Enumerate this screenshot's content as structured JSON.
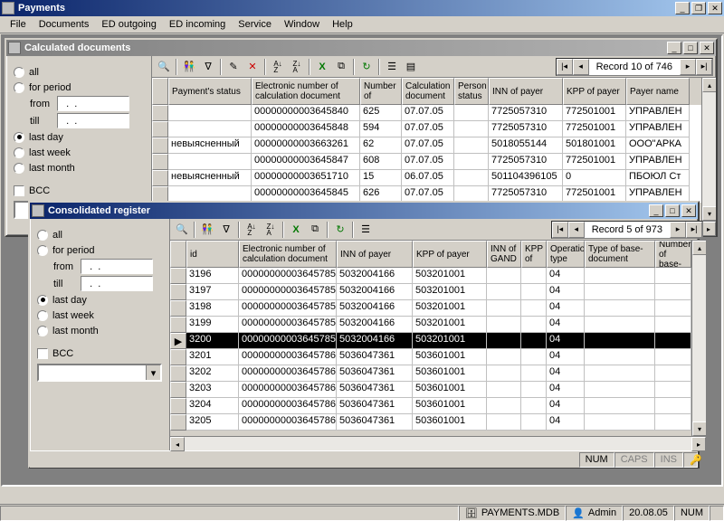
{
  "app": {
    "title": "Payments"
  },
  "menu": [
    "File",
    "Documents",
    "ED outgoing",
    "ED incoming",
    "Service",
    "Window",
    "Help"
  ],
  "filters": {
    "all": "all",
    "for_period": "for period",
    "from": "from",
    "till": "till",
    "last_day": "last day",
    "last_week": "last week",
    "last_month": "last month",
    "bcc": "BCC"
  },
  "calc": {
    "title": "Calculated documents",
    "nav": "Record 10 of 746",
    "cols": [
      "Payment's status",
      "Electronic number of calculation document",
      "Number of",
      "Calculation document",
      "Person status",
      "INN of payer",
      "KPP of payer",
      "Payer name"
    ],
    "widths": [
      92,
      120,
      46,
      58,
      38,
      82,
      70,
      70
    ],
    "rows": [
      [
        "",
        "00000000003645840",
        "625",
        "07.07.05",
        "",
        "7725057310",
        "772501001",
        "УПРАВЛЕН"
      ],
      [
        "",
        "00000000003645848",
        "594",
        "07.07.05",
        "",
        "7725057310",
        "772501001",
        "УПРАВЛЕН"
      ],
      [
        "невыясненный",
        "00000000003663261",
        "62",
        "07.07.05",
        "",
        "5018055144",
        "501801001",
        "ООО\"АРКА"
      ],
      [
        "",
        "00000000003645847",
        "608",
        "07.07.05",
        "",
        "7725057310",
        "772501001",
        "УПРАВЛЕН"
      ],
      [
        "невыясненный",
        "00000000003651710",
        "15",
        "06.07.05",
        "",
        "501104396105",
        "0",
        "ПБОЮЛ Ст"
      ],
      [
        "",
        "00000000003645845",
        "626",
        "07.07.05",
        "",
        "7725057310",
        "772501001",
        "УПРАВЛЕН"
      ]
    ]
  },
  "cons": {
    "title": "Consolidated register",
    "nav": "Record 5 of 973",
    "cols": [
      "id",
      "Electronic number of calculation document",
      "INN of payer",
      "KPP of payer",
      "INN of GAND",
      "KPP of",
      "Operation type",
      "Type of base-document",
      "Number of base-"
    ],
    "widths": [
      58,
      108,
      84,
      82,
      38,
      28,
      42,
      78,
      40
    ],
    "rows": [
      [
        "3196",
        "00000000003645785",
        "5032004166",
        "503201001",
        "",
        "",
        "04",
        "",
        ""
      ],
      [
        "3197",
        "00000000003645785",
        "5032004166",
        "503201001",
        "",
        "",
        "04",
        "",
        ""
      ],
      [
        "3198",
        "00000000003645785",
        "5032004166",
        "503201001",
        "",
        "",
        "04",
        "",
        ""
      ],
      [
        "3199",
        "00000000003645785",
        "5032004166",
        "503201001",
        "",
        "",
        "04",
        "",
        ""
      ],
      [
        "3200",
        "00000000003645785",
        "5032004166",
        "503201001",
        "",
        "",
        "04",
        "",
        ""
      ],
      [
        "3201",
        "00000000003645786",
        "5036047361",
        "503601001",
        "",
        "",
        "04",
        "",
        ""
      ],
      [
        "3202",
        "00000000003645786",
        "5036047361",
        "503601001",
        "",
        "",
        "04",
        "",
        ""
      ],
      [
        "3203",
        "00000000003645786",
        "5036047361",
        "503601001",
        "",
        "",
        "04",
        "",
        ""
      ],
      [
        "3204",
        "00000000003645786",
        "5036047361",
        "503601001",
        "",
        "",
        "04",
        "",
        ""
      ],
      [
        "3205",
        "00000000003645786",
        "5036047361",
        "503601001",
        "",
        "",
        "04",
        "",
        ""
      ]
    ],
    "selected": 4
  },
  "childstatus": {
    "num": "NUM",
    "caps": "CAPS",
    "ins": "INS"
  },
  "appstatus": {
    "db": "PAYMENTS.MDB",
    "user": "Admin",
    "date": "20.08.05",
    "num": "NUM"
  }
}
